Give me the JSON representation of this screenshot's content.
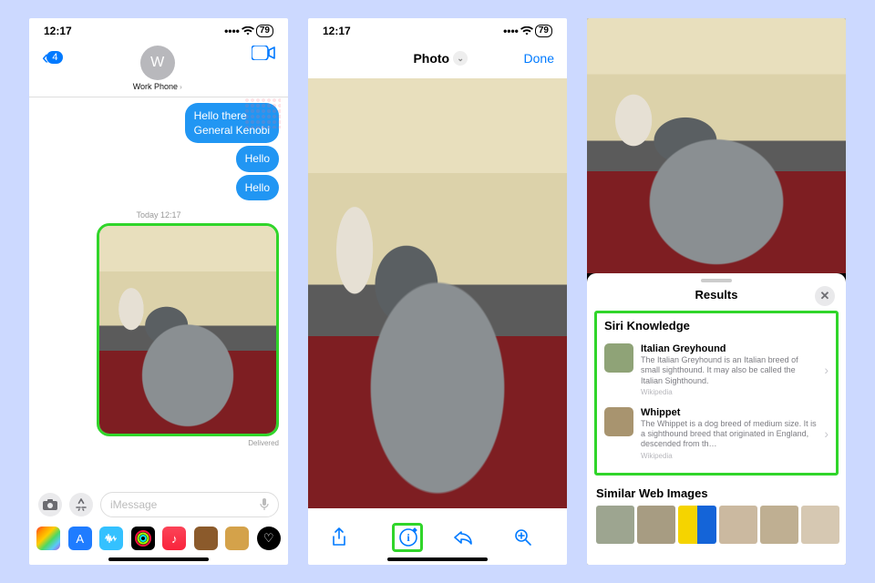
{
  "status": {
    "time": "12:17",
    "battery": "79",
    "sim_icon": "⚑"
  },
  "phone1": {
    "back_count": "4",
    "contact_initial": "W",
    "contact_name": "Work Phone",
    "bubbles": [
      "Hello there\nGeneral Kenobi",
      "Hello",
      "Hello"
    ],
    "timestamp": "Today 12:17",
    "delivered": "Delivered",
    "placeholder": "iMessage"
  },
  "phone2": {
    "title": "Photo",
    "done": "Done",
    "toolbar": {
      "share": "share",
      "info": "info",
      "reply": "reply",
      "zoom": "zoom"
    }
  },
  "phone3": {
    "sheet_title": "Results",
    "section_siri": "Siri Knowledge",
    "results": [
      {
        "title": "Italian Greyhound",
        "desc": "The Italian Greyhound is an Italian breed of small sighthound. It may also be called the Italian Sighthound.",
        "source": "Wikipedia"
      },
      {
        "title": "Whippet",
        "desc": "The Whippet is a dog breed of medium size. It is a sighthound breed that originated in England, descended from th…",
        "source": "Wikipedia"
      }
    ],
    "section_similar": "Similar Web Images"
  }
}
